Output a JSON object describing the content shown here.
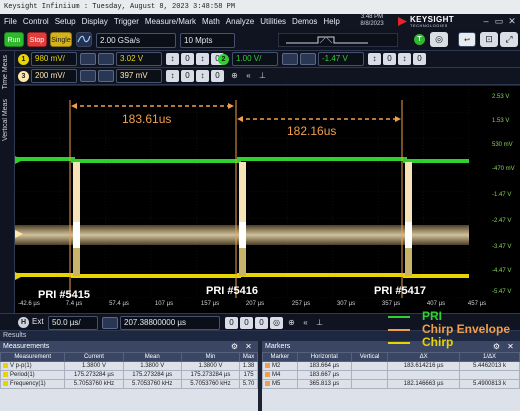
{
  "title_bar": "Keysight Infiniium : Tuesday, August 8, 2023 3:48:58 PM",
  "menu": [
    "File",
    "Control",
    "Setup",
    "Display",
    "Trigger",
    "Measure/Mark",
    "Math",
    "Analyze",
    "Utilities",
    "Demos",
    "Help"
  ],
  "clock": {
    "time": "3:48 PM",
    "date": "8/8/2023"
  },
  "brand": {
    "name": "KEYSIGHT",
    "sub": "TECHNOLOGIES"
  },
  "toolbar": {
    "run": "Run",
    "stop": "Stop",
    "single": "Single",
    "sample_rate": "2.00 GSa/s",
    "memory_depth": "10 Mpts",
    "trigger_badge": "T"
  },
  "channels": [
    {
      "num": "1",
      "scale": "980 mV/",
      "offset": "3.02 V",
      "color": "#e8d400"
    },
    {
      "num": "2",
      "scale": "1.00 V/",
      "offset": "-1.47 V",
      "color": "#2fd12f"
    },
    {
      "num": "3",
      "scale": "200 mV/",
      "offset": "397 mV",
      "color": "#ffe7b0"
    }
  ],
  "sidebar": {
    "tab1": "Time Meas",
    "tab2": "Vertical Meas"
  },
  "measurements_on_plot": {
    "left": "183.61us",
    "right": "182.16us"
  },
  "pri_labels": [
    "PRI #5415",
    "PRI #5416",
    "PRI #5417"
  ],
  "y_ticks": [
    "2.53 V",
    "1.53 V",
    "530 mV",
    "-470 mV",
    "-1.47 V",
    "-2.47 V",
    "-3.47 V",
    "-4.47 V",
    "-5.47 V"
  ],
  "x_ticks": [
    "-42.6 µs",
    "7.4 µs",
    "57.4 µs",
    "107 µs",
    "157 µs",
    "207 µs",
    "257 µs",
    "307 µs",
    "357 µs",
    "407 µs",
    "457 µs"
  ],
  "horizontal": {
    "badge": "H",
    "ext": "Ext",
    "scale": "50.0 µs/",
    "position": "207.38800000 µs"
  },
  "results": {
    "title": "Results",
    "measurements": {
      "title": "Measurements",
      "headers": [
        "Measurement",
        "Current",
        "Mean",
        "Min",
        "Max"
      ],
      "rows": [
        [
          "V p-p(1)",
          "1.3800 V",
          "1.3800 V",
          "1.3800 V",
          "1.38"
        ],
        [
          "Period(1)",
          "175.273284 µs",
          "175.273284 µs",
          "175.273284 µs",
          "175"
        ],
        [
          "Frequency(1)",
          "5.7053760 kHz",
          "5.7053760 kHz",
          "5.7053760 kHz",
          "5.70"
        ]
      ],
      "row_colors": [
        "#e8d400",
        "#e8d400",
        "#e8d400"
      ]
    },
    "markers": {
      "title": "Markers",
      "headers": [
        "Marker",
        "Horizontal",
        "Vertical",
        "ΔX",
        "1/ΔX"
      ],
      "rows": [
        [
          "M2",
          "183.664 µs",
          "",
          "183.614216 µs",
          "5.4462013 k"
        ],
        [
          "M4",
          "183.667 µs",
          "",
          "",
          ""
        ],
        [
          "M5",
          "365.813 µs",
          "",
          "182.146663 µs",
          "5.4900813 k"
        ]
      ]
    }
  },
  "legend": [
    {
      "label": "PRI",
      "color": "#2fd12f"
    },
    {
      "label": "Chirp Envelope",
      "color": "#f0a04a"
    },
    {
      "label": "Chirp",
      "color": "#e8d400"
    }
  ]
}
